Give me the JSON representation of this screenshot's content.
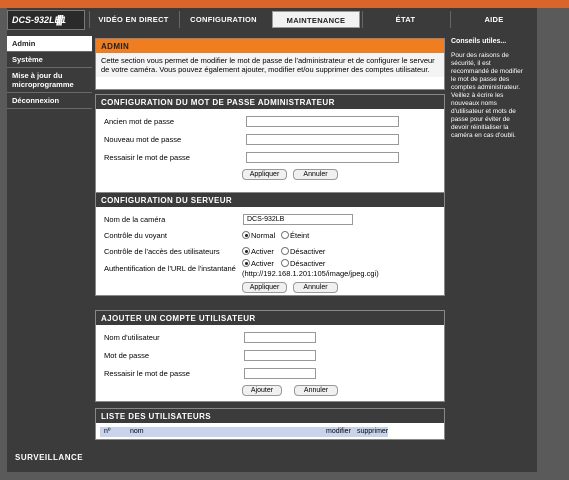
{
  "header": {
    "logo": "DCS-932LB1",
    "tabs": [
      "VIDÉO EN DIRECT",
      "CONFIGURATION",
      "MAINTENANCE",
      "ÉTAT",
      "AIDE"
    ],
    "active_tab": "MAINTENANCE"
  },
  "sidebar": {
    "items": [
      "Admin",
      "Système",
      "Mise à jour du microprogramme",
      "Déconnexion"
    ],
    "active": "Admin"
  },
  "admin": {
    "title": "ADMIN",
    "text": "Cette section vous permet de modifier le mot de passe de l'administrateur et de configurer le serveur de votre caméra. Vous pouvez également ajouter, modifier et/ou supprimer des comptes utilisateur."
  },
  "password": {
    "title": "CONFIGURATION DU MOT DE PASSE ADMINISTRATEUR",
    "old_label": "Ancien mot de passe",
    "new_label": "Nouveau mot de passe",
    "confirm_label": "Ressaisir le mot de passe",
    "apply": "Appliquer",
    "cancel": "Annuler"
  },
  "server": {
    "title": "CONFIGURATION DU SERVEUR",
    "camera_name_label": "Nom de la caméra",
    "camera_name_value": "DCS-932LB",
    "led_label": "Contrôle du voyant",
    "led_on": "Normal",
    "led_off": "Éteint",
    "access_label": "Contrôle de l'accès des utilisateurs",
    "enable": "Activer",
    "disable": "Désactiver",
    "snapshot_label": "Authentification de l'URL de l'instantané",
    "snapshot_url": "(http://192.168.1.201:105/image/jpeg.cgi)",
    "apply": "Appliquer",
    "cancel": "Annuler"
  },
  "add_user": {
    "title": "AJOUTER UN COMPTE UTILISATEUR",
    "username_label": "Nom d'utilisateur",
    "password_label": "Mot de passe",
    "confirm_label": "Ressaisir le mot de passe",
    "add": "Ajouter",
    "cancel": "Annuler"
  },
  "user_list": {
    "title": "LISTE DES UTILISATEURS",
    "columns": [
      "nº",
      "nom",
      "modifier",
      "supprimer"
    ]
  },
  "tips": {
    "title": "Conseils utiles...",
    "text": "Pour des raisons de sécurité, il est recommandé de modifier le mot de passe des comptes administrateur. Veillez à écrire les nouveaux noms d'utilisateur et mots de passe pour éviter de devoir réinitialiser la caméra en cas d'oubli."
  },
  "footer": {
    "brand": "SURVEILLANCE"
  }
}
